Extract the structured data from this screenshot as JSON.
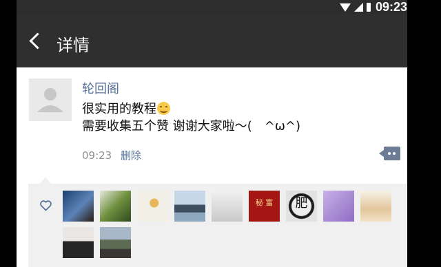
{
  "status": {
    "time": "09:23"
  },
  "header": {
    "title": "详情"
  },
  "post": {
    "author": "轮回阁",
    "line1": "很实用的教程",
    "line2": "需要收集五个赞 谢谢大家啦～(　^ω^)",
    "time": "09:23",
    "delete_label": "删除"
  },
  "likes": {
    "avatars": [
      {
        "name": "liker-1",
        "text": ""
      },
      {
        "name": "liker-2",
        "text": ""
      },
      {
        "name": "liker-3",
        "text": ""
      },
      {
        "name": "liker-4",
        "text": ""
      },
      {
        "name": "liker-5",
        "text": ""
      },
      {
        "name": "liker-6",
        "text": "秘 富"
      },
      {
        "name": "liker-7",
        "text": "肥"
      },
      {
        "name": "liker-8",
        "text": ""
      },
      {
        "name": "liker-9",
        "text": ""
      },
      {
        "name": "liker-10",
        "text": ""
      },
      {
        "name": "liker-11",
        "text": ""
      }
    ]
  },
  "colors": {
    "header": "#2f2f2f",
    "link": "#56709a",
    "likes_bg": "#f0f0f0"
  }
}
